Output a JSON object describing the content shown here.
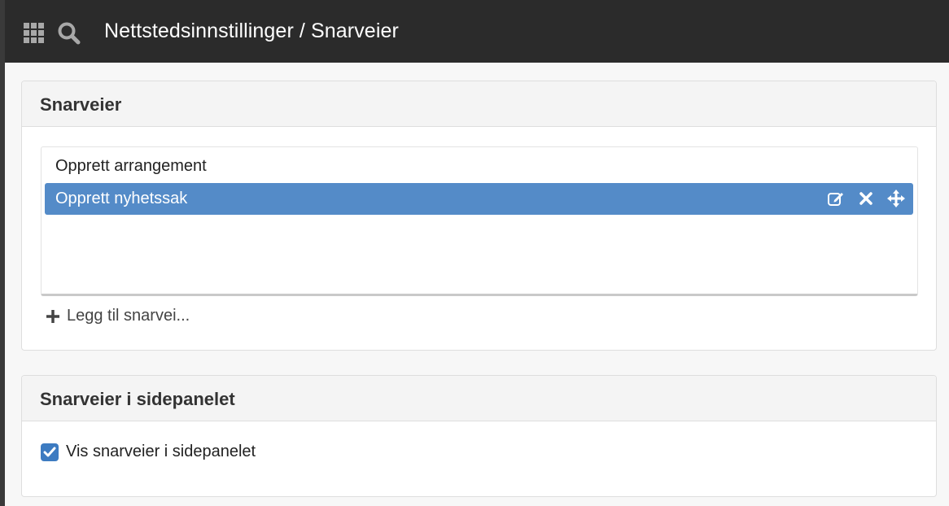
{
  "header": {
    "title": "Nettstedsinnstillinger / Snarveier",
    "apps_icon": "grid-icon",
    "search_icon": "search-icon"
  },
  "shortcuts_panel": {
    "heading": "Snarveier",
    "items": [
      {
        "label": "Opprett arrangement",
        "selected": false
      },
      {
        "label": "Opprett nyhetssak",
        "selected": true
      }
    ],
    "row_actions": [
      "edit-icon",
      "close-icon",
      "move-icon"
    ],
    "add_label": "Legg til snarvei..."
  },
  "sidebar_panel": {
    "heading": "Snarveier i sidepanelet",
    "checkbox_label": "Vis snarveier i sidepanelet",
    "checked": true
  },
  "colors": {
    "topbar": "#2b2b2b",
    "selected_row": "#548bc8",
    "checkbox": "#3d7bc1"
  }
}
